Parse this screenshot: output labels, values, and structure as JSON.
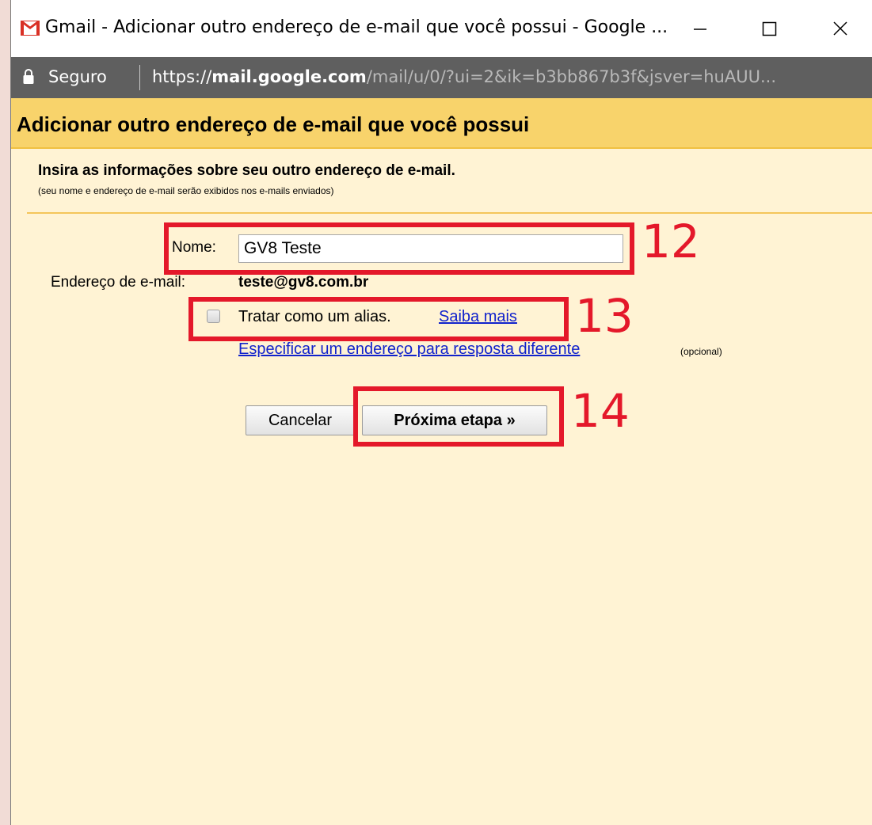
{
  "window": {
    "title": "Gmail - Adicionar outro endereço de e-mail que você possui - Google ...",
    "brand_color": "#d93025"
  },
  "addressbar": {
    "secure_label": "Seguro",
    "url_scheme": "https://",
    "url_host": "mail.google.com",
    "url_path": "/mail/u/0/?ui=2&ik=b3bb867b3f&jsver=huAUU..."
  },
  "dialog": {
    "title": "Adicionar outro endereço de e-mail que você possui",
    "header_color": "#f8d36b",
    "intro_heading": "Insira as informações sobre seu outro endereço de e-mail.",
    "intro_sub": "(seu nome e endereço de e-mail serão exibidos nos e-mails enviados)",
    "name_label": "Nome:",
    "name_value": "GV8 Teste",
    "email_label": "Endereço de e-mail:",
    "email_value": "teste@gv8.com.br",
    "alias_label": "Tratar como um alias.",
    "alias_checked": false,
    "learn_more": "Saiba mais",
    "reply_link": "Especificar um endereço para resposta diferente",
    "optional": "(opcional)",
    "cancel_button": "Cancelar",
    "next_button": "Próxima etapa »"
  },
  "annotations": {
    "color": "#e4182a",
    "labels": [
      "12",
      "13",
      "14"
    ]
  },
  "icons": {
    "gmail": "gmail-logo-icon",
    "lock": "lock-icon",
    "minimize": "minimize-icon",
    "maximize": "maximize-icon",
    "close": "close-icon"
  }
}
